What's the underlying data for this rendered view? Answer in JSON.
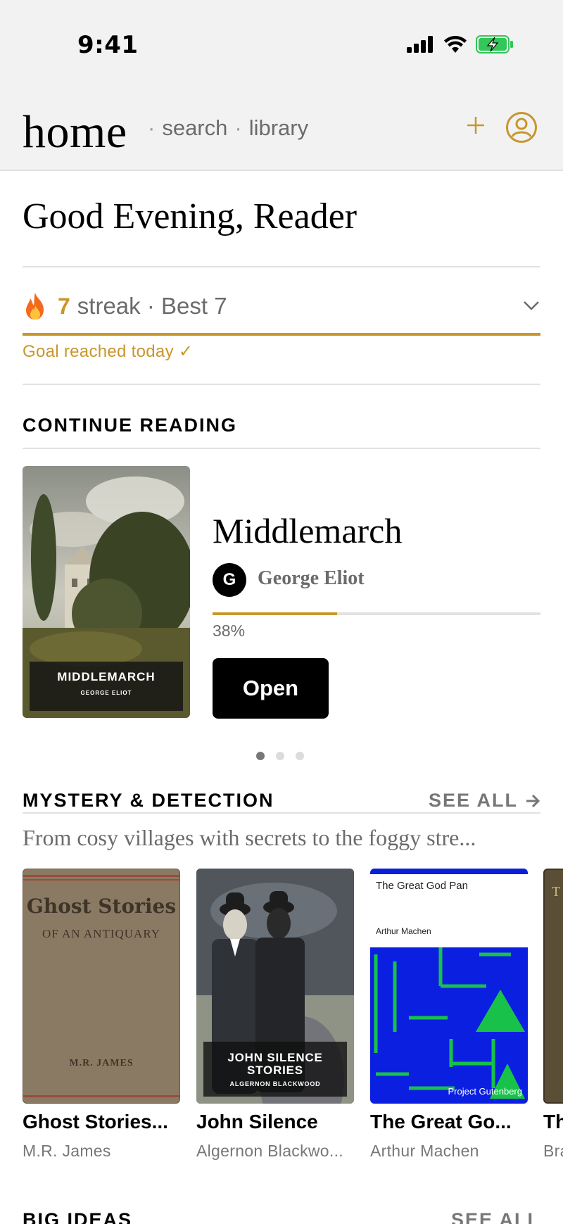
{
  "status_bar": {
    "time": "9:41"
  },
  "header": {
    "home_label": "home",
    "search_label": "search",
    "library_label": "library",
    "separator": "·",
    "accent_color": "#c9962a"
  },
  "greeting": "Good Evening, Reader",
  "streak": {
    "count": "7",
    "text": "streak · Best 7",
    "goal_text": "Goal reached today ✓",
    "icon": "fire-icon"
  },
  "continue_reading": {
    "section_title": "CONTINUE READING",
    "book": {
      "title": "Middlemarch",
      "author": "George Eliot",
      "author_initial": "G",
      "cover_title": "MIDDLEMARCH",
      "cover_author": "GEORGE ELIOT",
      "progress_text": "38%",
      "progress_value": 0.38,
      "open_label": "Open"
    },
    "page_dots": 3,
    "active_dot": 0
  },
  "mystery_section": {
    "title": "MYSTERY & DETECTION",
    "see_all": "SEE ALL",
    "description": "From cosy villages with secrets to the foggy stre...",
    "books": [
      {
        "title": "Ghost Stories...",
        "author": "M.R. James",
        "cover_line1": "Ghost Stories",
        "cover_line2": "OF AN ANTIQUARY",
        "cover_author": "M.R. JAMES"
      },
      {
        "title": "John Silence",
        "author": "Algernon Blackwo...",
        "cover_title": "JOHN SILENCE STORIES",
        "cover_author": "ALGERNON BLACKWOOD"
      },
      {
        "title": "The Great Go...",
        "author": "Arthur Machen",
        "cover_title": "The Great God Pan",
        "cover_author": "Arthur Machen",
        "cover_publisher": "Project Gutenberg"
      },
      {
        "title": "Th",
        "author": "Bra"
      }
    ]
  },
  "next_section": {
    "title": "BIG IDEAS",
    "see_all": "SEE ALL"
  }
}
